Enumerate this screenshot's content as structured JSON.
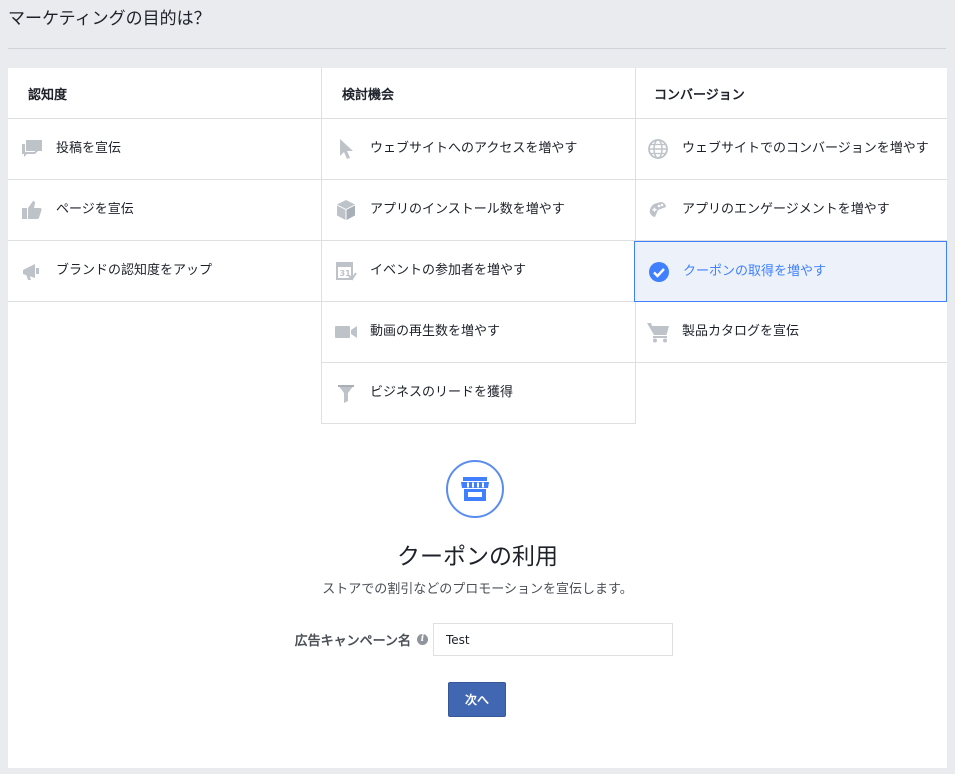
{
  "header": {
    "title": "マーケティングの目的は？"
  },
  "columns": [
    {
      "heading": "認知度",
      "items": [
        {
          "label": "投稿を宣伝",
          "icon": "speech-bubbles-icon"
        },
        {
          "label": "ページを宣伝",
          "icon": "thumbs-up-icon"
        },
        {
          "label": "ブランドの認知度をアップ",
          "icon": "megaphone-icon"
        }
      ]
    },
    {
      "heading": "検討機会",
      "items": [
        {
          "label": "ウェブサイトへのアクセスを増やす",
          "icon": "cursor-icon"
        },
        {
          "label": "アプリのインストール数を増やす",
          "icon": "box-icon"
        },
        {
          "label": "イベントの参加者を増やす",
          "icon": "calendar-icon"
        },
        {
          "label": "動画の再生数を増やす",
          "icon": "video-camera-icon"
        },
        {
          "label": "ビジネスのリードを獲得",
          "icon": "funnel-icon"
        }
      ]
    },
    {
      "heading": "コンバージョン",
      "items": [
        {
          "label": "ウェブサイトでのコンバージョンを増やす",
          "icon": "globe-icon"
        },
        {
          "label": "アプリのエンゲージメントを増やす",
          "icon": "game-controller-icon"
        },
        {
          "label": "クーポンの取得を増やす",
          "icon": "check-circle-icon",
          "selected": true
        },
        {
          "label": "製品カタログを宣伝",
          "icon": "shopping-cart-icon"
        }
      ]
    }
  ],
  "detail": {
    "icon": "storefront-icon",
    "title": "クーポンの利用",
    "description": "ストアでの割引などのプロモーションを宣伝します。"
  },
  "form": {
    "campaign_name_label": "広告キャンペーン名",
    "campaign_name_value": "Test",
    "info_icon": "info-icon"
  },
  "next_button": {
    "label": "次へ"
  },
  "colors": {
    "accent": "#4080ff",
    "button": "#4267b2",
    "icon_gray": "#bec3c9",
    "selected_bg": "#edf2fa"
  }
}
